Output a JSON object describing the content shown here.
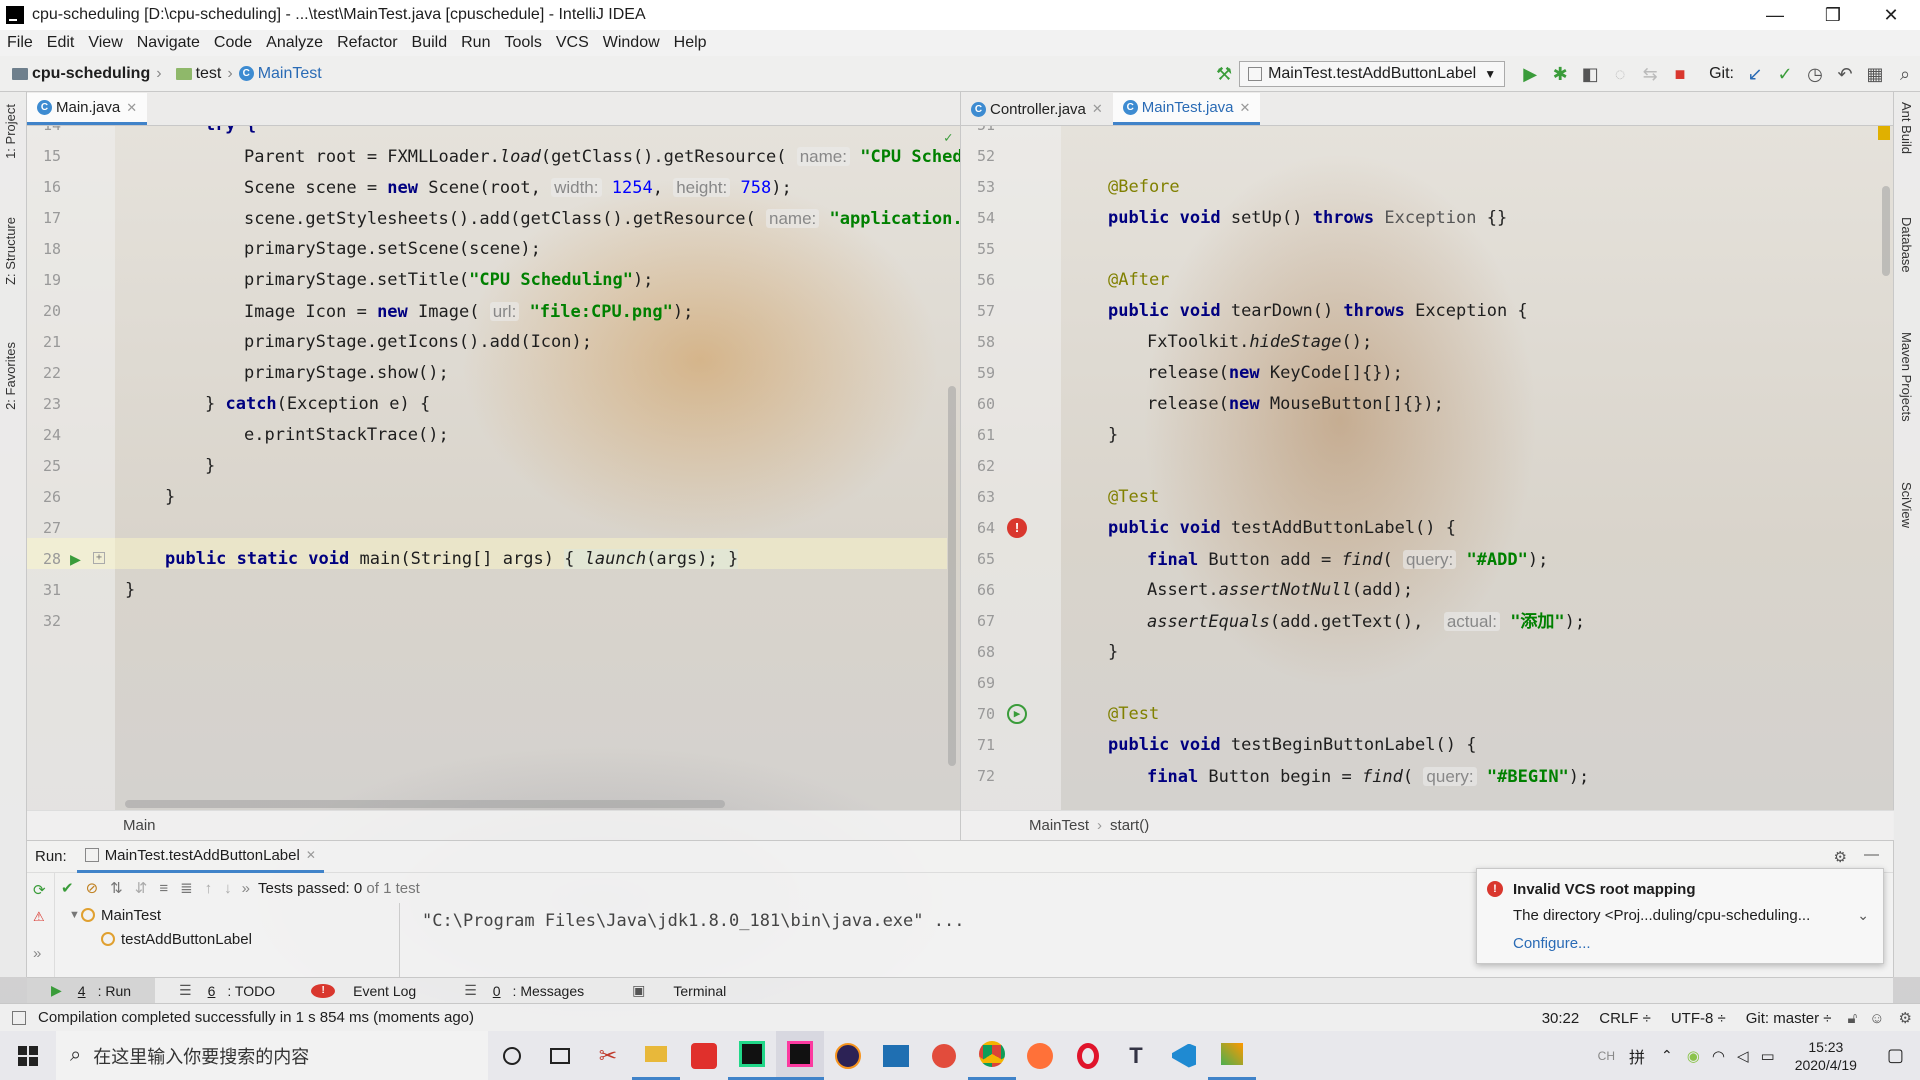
{
  "window": {
    "title": "cpu-scheduling [D:\\cpu-scheduling] - ...\\test\\MainTest.java [cpuschedule] - IntelliJ IDEA",
    "controls": {
      "minimize": "—",
      "restore": "❒",
      "close": "✕"
    }
  },
  "menu": [
    "File",
    "Edit",
    "View",
    "Navigate",
    "Code",
    "Analyze",
    "Refactor",
    "Build",
    "Run",
    "Tools",
    "VCS",
    "Window",
    "Help"
  ],
  "breadcrumbs": {
    "project": "cpu-scheduling",
    "folder": "test",
    "file": "MainTest"
  },
  "toolbar": {
    "run_config": "MainTest.testAddButtonLabel",
    "git_label": "Git:"
  },
  "left_tool_tabs": {
    "project": "1: Project",
    "structure": "Z: Structure",
    "favorites": "2: Favorites"
  },
  "right_tool_tabs": {
    "ant": "Ant Build",
    "database": "Database",
    "maven": "Maven Projects",
    "sciview": "SciView"
  },
  "left_editor": {
    "tab": "Main.java",
    "crumb": "Main",
    "lines": [
      {
        "n": "14"
      },
      {
        "n": "15"
      },
      {
        "n": "16"
      },
      {
        "n": "17"
      },
      {
        "n": "18"
      },
      {
        "n": "19"
      },
      {
        "n": "20"
      },
      {
        "n": "21"
      },
      {
        "n": "22"
      },
      {
        "n": "23"
      },
      {
        "n": "24"
      },
      {
        "n": "25"
      },
      {
        "n": "26"
      },
      {
        "n": "27"
      },
      {
        "n": "28"
      },
      {
        "n": "31"
      },
      {
        "n": "32"
      }
    ],
    "code": {
      "l14": "try {",
      "l15_a": "Parent root = FXMLLoader.",
      "l15_b": "load",
      "l15_c": "(getClass().getResource(",
      "l15_hint": "name:",
      "l15_str": "\"CPU Sched",
      "l16_a": "Scene scene = ",
      "l16_kw": "new",
      "l16_b": " Scene(root, ",
      "l16_h1": "width:",
      "l16_n1": "1254",
      "l16_c": ", ",
      "l16_h2": "height:",
      "l16_n2": "758",
      "l16_d": ");",
      "l17_a": "scene.getStylesheets().add(getClass().getResource(",
      "l17_hint": "name:",
      "l17_str": "\"application.",
      "l18": "primaryStage.setScene(scene);",
      "l19_a": "primaryStage.setTitle(",
      "l19_str": "\"CPU Scheduling\"",
      "l19_b": ");",
      "l20_a": "Image Icon = ",
      "l20_kw": "new",
      "l20_b": " Image(",
      "l20_hint": "url:",
      "l20_str": "\"file:CPU.png\"",
      "l20_c": ");",
      "l21": "primaryStage.getIcons().add(Icon);",
      "l22": "primaryStage.show();",
      "l23_a": "} ",
      "l23_kw": "catch",
      "l23_b": "(Exception e) {",
      "l24": "e.printStackTrace();",
      "l25": "}",
      "l26": "}",
      "l28_kw": "public static void",
      "l28_a": " main(String[] args) ",
      "l28_b": "{ ",
      "l28_it": "launch",
      "l28_c": "(args); }",
      "l31": "}"
    }
  },
  "right_editor": {
    "tabs": [
      "Controller.java",
      "MainTest.java"
    ],
    "crumb": [
      "MainTest",
      "start()"
    ],
    "lines": [
      "51",
      "52",
      "53",
      "54",
      "55",
      "56",
      "57",
      "58",
      "59",
      "60",
      "61",
      "62",
      "63",
      "64",
      "65",
      "66",
      "67",
      "68",
      "69",
      "70",
      "71",
      "72"
    ],
    "code": {
      "l53": "@Before",
      "l54_kw": "public void",
      "l54_a": " setUp() ",
      "l54_kw2": "throws",
      "l54_b": " Exception",
      "l54_c": " {}",
      "l56": "@After",
      "l57_kw": "public void",
      "l57_a": " tearDown() ",
      "l57_kw2": "throws",
      "l57_b": " Exception {",
      "l58_a": "FxToolkit.",
      "l58_it": "hideStage",
      "l58_b": "();",
      "l59_a": "release(",
      "l59_kw": "new",
      "l59_b": " KeyCode[]{});",
      "l60_a": "release(",
      "l60_kw": "new",
      "l60_b": " MouseButton[]{});",
      "l61": "}",
      "l63": "@Test",
      "l64_kw": "public void",
      "l64_a": " testAddButtonLabel() {",
      "l65_kw": "final",
      "l65_a": " Button add = ",
      "l65_it": "find",
      "l65_b": "(",
      "l65_hint": "query:",
      "l65_str": "\"#ADD\"",
      "l65_c": ");",
      "l66_a": "Assert.",
      "l66_it": "assertNotNull",
      "l66_b": "(add);",
      "l67_it": "assertEquals",
      "l67_a": "(add.getText(),",
      "l67_hint": "actual:",
      "l67_str": "\"添加\"",
      "l67_b": ");",
      "l68": "}",
      "l70": "@Test",
      "l71_kw": "public void",
      "l71_a": " testBeginButtonLabel() {",
      "l72_kw": "final",
      "l72_a": " Button begin = ",
      "l72_it": "find",
      "l72_b": "(",
      "l72_hint": "query:",
      "l72_str": "\"#BEGIN\"",
      "l72_c": ");"
    }
  },
  "run_panel": {
    "label": "Run:",
    "tab": "MainTest.testAddButtonLabel",
    "tests_passed_label": "Tests passed: ",
    "tests_passed_count": "0",
    "tests_passed_total": " of 1 test",
    "tree_root": "MainTest",
    "tree_child": "testAddButtonLabel",
    "console_line": "\"C:\\Program Files\\Java\\jdk1.8.0_181\\bin\\java.exe\" ..."
  },
  "notification": {
    "title": "Invalid VCS root mapping",
    "body": "The directory <Proj...duling/cpu-scheduling...",
    "link": "Configure..."
  },
  "bottom_tabs": [
    {
      "key": "4",
      "label": ": Run"
    },
    {
      "key": "6",
      "label": ": TODO"
    },
    {
      "key": "",
      "label": "Event Log"
    },
    {
      "key": "0",
      "label": ": Messages"
    },
    {
      "key": "",
      "label": "Terminal"
    }
  ],
  "status": {
    "message": "Compilation completed successfully in 1 s 854 ms (moments ago)",
    "position": "30:22",
    "line_sep": "CRLF ÷",
    "encoding": "UTF-8 ÷",
    "git": "Git: master ÷"
  },
  "taskbar": {
    "search_placeholder": "在这里输入你要搜索的内容",
    "ime": "拼",
    "ime_ch": "CH",
    "time": "15:23",
    "date": "2020/4/19",
    "apps": [
      "cortana-icon",
      "task-view-icon",
      "paint-icon",
      "file-explorer-icon",
      "youdao-icon",
      "pycharm-icon",
      "intellij-icon",
      "eclipse-icon",
      "network-tool-icon",
      "app-swirl-icon",
      "chrome-icon",
      "firefox-icon",
      "opera-icon",
      "typora-icon",
      "vscode-icon",
      "misc-app-icon"
    ]
  },
  "colors": {
    "accent": "#4083c9",
    "error": "#d9372e",
    "success": "#3a9c3a",
    "keyword": "#000080",
    "string": "#008000"
  }
}
